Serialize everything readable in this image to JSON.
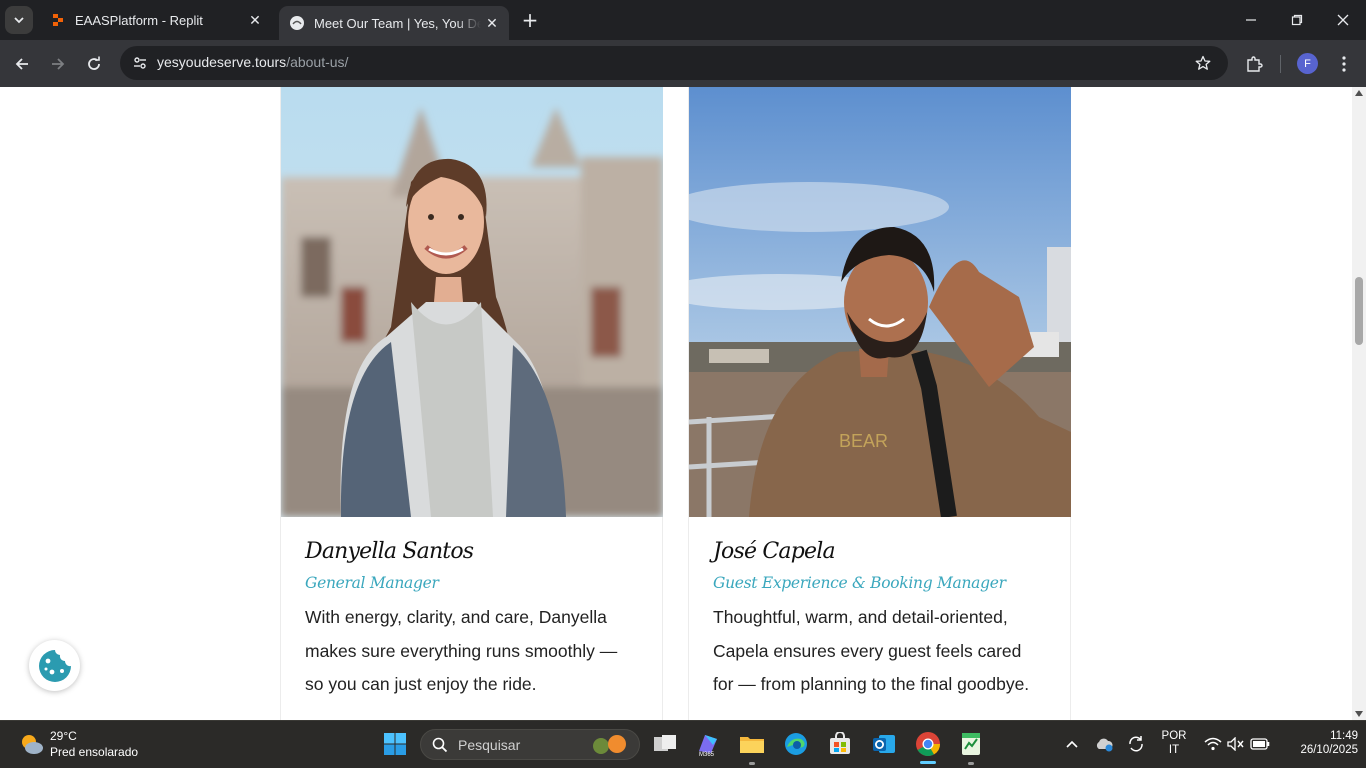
{
  "browser": {
    "tabs": [
      {
        "title": "EAASPlatform - Replit",
        "active": false
      },
      {
        "title": "Meet Our Team | Yes, You Deserve",
        "active": true
      }
    ],
    "url_domain": "yesyoudeserve.tours",
    "url_path": "/about-us/",
    "profile_initial": "F"
  },
  "team": [
    {
      "name": "Danyella Santos",
      "role": "General Manager",
      "bio": "With energy, clarity, and care, Danyella makes sure everything runs smoothly — so you can just enjoy the ride."
    },
    {
      "name": "José Capela",
      "role": "Guest Experience & Booking Manager",
      "bio": "Thoughtful, warm, and detail-oriented, Capela ensures every guest feels cared for — from planning to the final goodbye."
    }
  ],
  "taskbar": {
    "weather_temp": "29°C",
    "weather_desc": "Pred ensolarado",
    "search_placeholder": "Pesquisar",
    "lang_line1": "POR",
    "lang_line2": "IT",
    "time": "11:49",
    "date": "26/10/2025"
  },
  "colors": {
    "accent_role": "#3aa7bd",
    "chrome_dark": "#202124",
    "chrome_toolbar": "#35363a"
  }
}
